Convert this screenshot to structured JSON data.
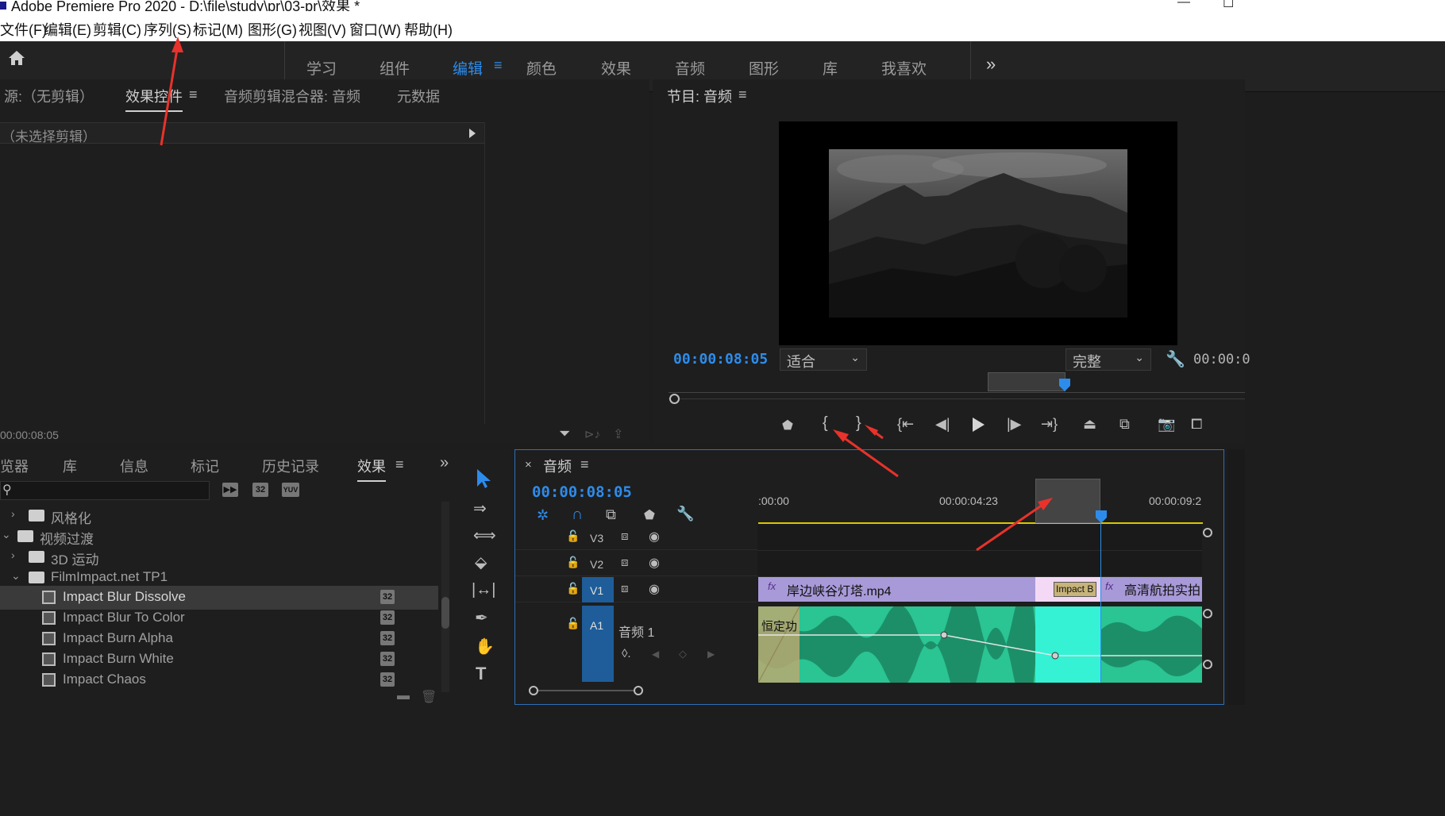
{
  "window": {
    "title": "Adobe Premiere Pro 2020 - D:\\file\\study\\pr\\03-pr\\效果 *",
    "minimize": "—",
    "maximize": "☐"
  },
  "menu": [
    {
      "label": "文件(F)"
    },
    {
      "label": "编辑(E)"
    },
    {
      "label": "剪辑(C)"
    },
    {
      "label": "序列(S)"
    },
    {
      "label": "标记(M)"
    },
    {
      "label": "图形(G)"
    },
    {
      "label": "视图(V)"
    },
    {
      "label": "窗口(W)"
    },
    {
      "label": "帮助(H)"
    }
  ],
  "workspaces": {
    "tabs": [
      {
        "label": "学习"
      },
      {
        "label": "组件"
      },
      {
        "label": "编辑"
      },
      {
        "label": "颜色"
      },
      {
        "label": "效果"
      },
      {
        "label": "音频"
      },
      {
        "label": "图形"
      },
      {
        "label": "库"
      },
      {
        "label": "我喜欢"
      }
    ],
    "active_index": 2,
    "overflow": "»"
  },
  "source_panel": {
    "tabs": [
      {
        "label": "源:（无剪辑）"
      },
      {
        "label": "效果控件"
      },
      {
        "label": "音频剪辑混合器: 音频"
      },
      {
        "label": "元数据"
      }
    ],
    "active_index": 1,
    "no_clip_text": "（未选择剪辑）",
    "timecode": "00:00:08:05"
  },
  "program_panel": {
    "title": "节目: 音频",
    "timecode": "00:00:08:05",
    "fit_value": "适合",
    "quality_value": "完整",
    "duration": "00:00:0"
  },
  "effects_panel": {
    "tabs": [
      {
        "label": "览器"
      },
      {
        "label": "库"
      },
      {
        "label": "信息"
      },
      {
        "label": "标记"
      },
      {
        "label": "历史记录"
      },
      {
        "label": "效果"
      }
    ],
    "active_index": 5,
    "overflow": "»",
    "badges": [
      "32",
      "YUV"
    ],
    "tree": [
      {
        "label": "风格化",
        "kind": "folder",
        "twisty": "›"
      },
      {
        "label": "视频过渡",
        "kind": "folder",
        "twisty": "⌄"
      },
      {
        "label": "3D 运动",
        "kind": "folder",
        "twisty": "›"
      },
      {
        "label": "FilmImpact.net TP1",
        "kind": "folder",
        "twisty": "⌄"
      },
      {
        "label": "Impact Blur Dissolve",
        "kind": "item",
        "badge": "32",
        "selected": true
      },
      {
        "label": "Impact Blur To Color",
        "kind": "item",
        "badge": "32"
      },
      {
        "label": "Impact Burn Alpha",
        "kind": "item",
        "badge": "32"
      },
      {
        "label": "Impact Burn White",
        "kind": "item",
        "badge": "32"
      },
      {
        "label": "Impact Chaos",
        "kind": "item",
        "badge": "32"
      }
    ]
  },
  "timeline": {
    "title": "音频",
    "close": "×",
    "timecode": "00:00:08:05",
    "ruler": [
      ":00:00",
      "00:00:04:23",
      "00:00:09:2"
    ],
    "tracks": [
      {
        "name": "V3"
      },
      {
        "name": "V2"
      },
      {
        "name": "V1"
      },
      {
        "name": "A1"
      }
    ],
    "audio_track_name": "音频 1",
    "clips": {
      "v1_a": "岸边峡谷灯塔.mp4",
      "v1_transition": "Impact B",
      "v1_b": "高清航拍实拍",
      "a1_transition": "恒定功",
      "fx": "fx"
    }
  },
  "colors": {
    "accent": "#2d8ceb",
    "clip_video": "#a89ad8",
    "clip_audio": "#2bc493",
    "arrow": "#e8322b"
  }
}
